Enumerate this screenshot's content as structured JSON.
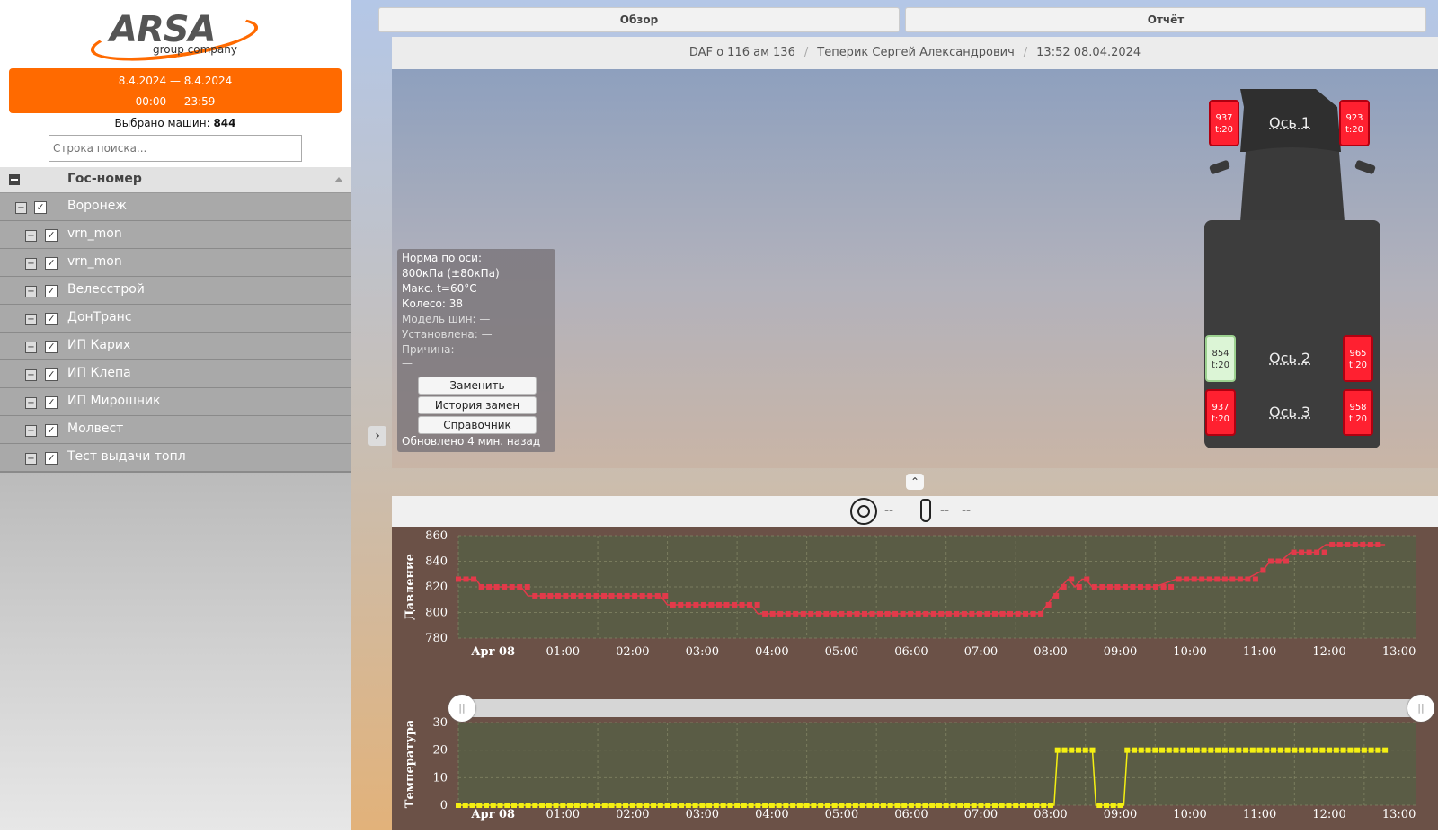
{
  "sidebar": {
    "logo": {
      "text": "ARSA",
      "subtitle": "group company"
    },
    "date_range": {
      "dates": "8.4.2024 — 8.4.2024",
      "times": "00:00 — 23:59"
    },
    "selected_label": "Выбрано машин:",
    "selected_count": "844",
    "search_placeholder": "Строка поиска...",
    "tree_header": "Гос-номер",
    "group": {
      "label": "Воронеж",
      "checked": true
    },
    "items": [
      {
        "label": "vrn_mon",
        "checked": true
      },
      {
        "label": "vrn_mon",
        "checked": true
      },
      {
        "label": "Велесстрой",
        "checked": true
      },
      {
        "label": "ДонТранс",
        "checked": true
      },
      {
        "label": "ИП Карих",
        "checked": true
      },
      {
        "label": "ИП Клепа",
        "checked": true
      },
      {
        "label": "ИП Мирошник",
        "checked": true
      },
      {
        "label": "Молвест",
        "checked": true
      },
      {
        "label": "Тест выдачи топл",
        "checked": true
      }
    ]
  },
  "tabs": {
    "overview": "Обзор",
    "report": "Отчёт"
  },
  "info_bar": {
    "vehicle": "DAF о 116 ам 136",
    "driver": "Теперик Сергей Александрович",
    "datetime": "13:52 08.04.2024"
  },
  "axle_info": {
    "norm_title": "Норма по оси:",
    "norm_value": "800кПа (±80кПа)",
    "max_temp": "Макс. t=60°C",
    "wheel": "Колесо: 38",
    "tire_model": "Модель шин:  —",
    "installed": "Установлена:  —",
    "reason": "Причина:",
    "reason_value": "—",
    "btn_replace": "Заменить",
    "btn_history": "История замен",
    "btn_reference": "Справочник",
    "updated": "Обновлено 4 мин. назад"
  },
  "truck": {
    "axles": [
      {
        "label": "Ось 1",
        "left": {
          "pressure": "937",
          "temp": "t:20",
          "status": "alarm"
        },
        "right": {
          "pressure": "923",
          "temp": "t:20",
          "status": "alarm"
        }
      },
      {
        "label": "Ось 2",
        "left": {
          "pressure": "854",
          "temp": "t:20",
          "status": "ok"
        },
        "right": {
          "pressure": "965",
          "temp": "t:20",
          "status": "alarm"
        }
      },
      {
        "label": "Ось 3",
        "left": {
          "pressure": "937",
          "temp": "t:20",
          "status": "alarm"
        },
        "right": {
          "pressure": "958",
          "temp": "t:20",
          "status": "alarm"
        }
      }
    ]
  },
  "readouts": {
    "pressure": "--",
    "temp1": "--",
    "temp2": "--"
  },
  "icons": {
    "toggle": "chevron-up-icon",
    "collapse": "chevron-right-icon",
    "pressure": "gauge-icon",
    "temperature": "thermometer-icon"
  },
  "colors": {
    "accent": "#ff6a00",
    "alarm": "#ff2030",
    "ok": "#dcf5d6",
    "pressure_series": "#e23a4a",
    "temp_series": "#f4ef12"
  },
  "chart_data": [
    {
      "type": "line",
      "ylabel": "Давление",
      "ylim": [
        780,
        860
      ],
      "yticks": [
        780,
        800,
        820,
        840,
        860
      ],
      "xtick_labels": [
        "Apr 08",
        "01:00",
        "02:00",
        "03:00",
        "04:00",
        "05:00",
        "06:00",
        "07:00",
        "08:00",
        "09:00",
        "10:00",
        "11:00",
        "12:00",
        "13:00"
      ],
      "x_hours": [
        0,
        0.25,
        0.33,
        0.9,
        1.0,
        1.9,
        2.0,
        2.9,
        3.0,
        3.9,
        4.0,
        4.2,
        4.3,
        4.4,
        6.0,
        8.0,
        8.35,
        8.45,
        8.55,
        8.65,
        8.75,
        8.85,
        8.95,
        9.0,
        9.1,
        9.3,
        9.35,
        9.55,
        10.0,
        10.3,
        10.6,
        11.0,
        11.3,
        11.55,
        11.65,
        11.8,
        11.95,
        12.3,
        12.45,
        12.95,
        13.3
      ],
      "series": [
        {
          "values": [
            826,
            826,
            820,
            820,
            813,
            813,
            813,
            813,
            806,
            806,
            806,
            806,
            799,
            799,
            799,
            799,
            799,
            806,
            813,
            820,
            826,
            820,
            826,
            826,
            820,
            820,
            820,
            820,
            820,
            826,
            826,
            826,
            826,
            833,
            840,
            840,
            847,
            847,
            853,
            853,
            853
          ]
        }
      ]
    },
    {
      "type": "line",
      "ylabel": "Температура",
      "ylim": [
        0,
        30
      ],
      "yticks": [
        0,
        10,
        20,
        30
      ],
      "xtick_labels": [
        "Apr 08",
        "01:00",
        "02:00",
        "03:00",
        "04:00",
        "05:00",
        "06:00",
        "07:00",
        "08:00",
        "09:00",
        "10:00",
        "11:00",
        "12:00",
        "13:00"
      ],
      "x_hours": [
        0,
        8.55,
        8.6,
        9.1,
        9.15,
        9.55,
        9.6,
        13.33
      ],
      "series": [
        {
          "values": [
            0,
            0,
            20,
            20,
            0,
            0,
            20,
            20
          ]
        }
      ]
    }
  ]
}
